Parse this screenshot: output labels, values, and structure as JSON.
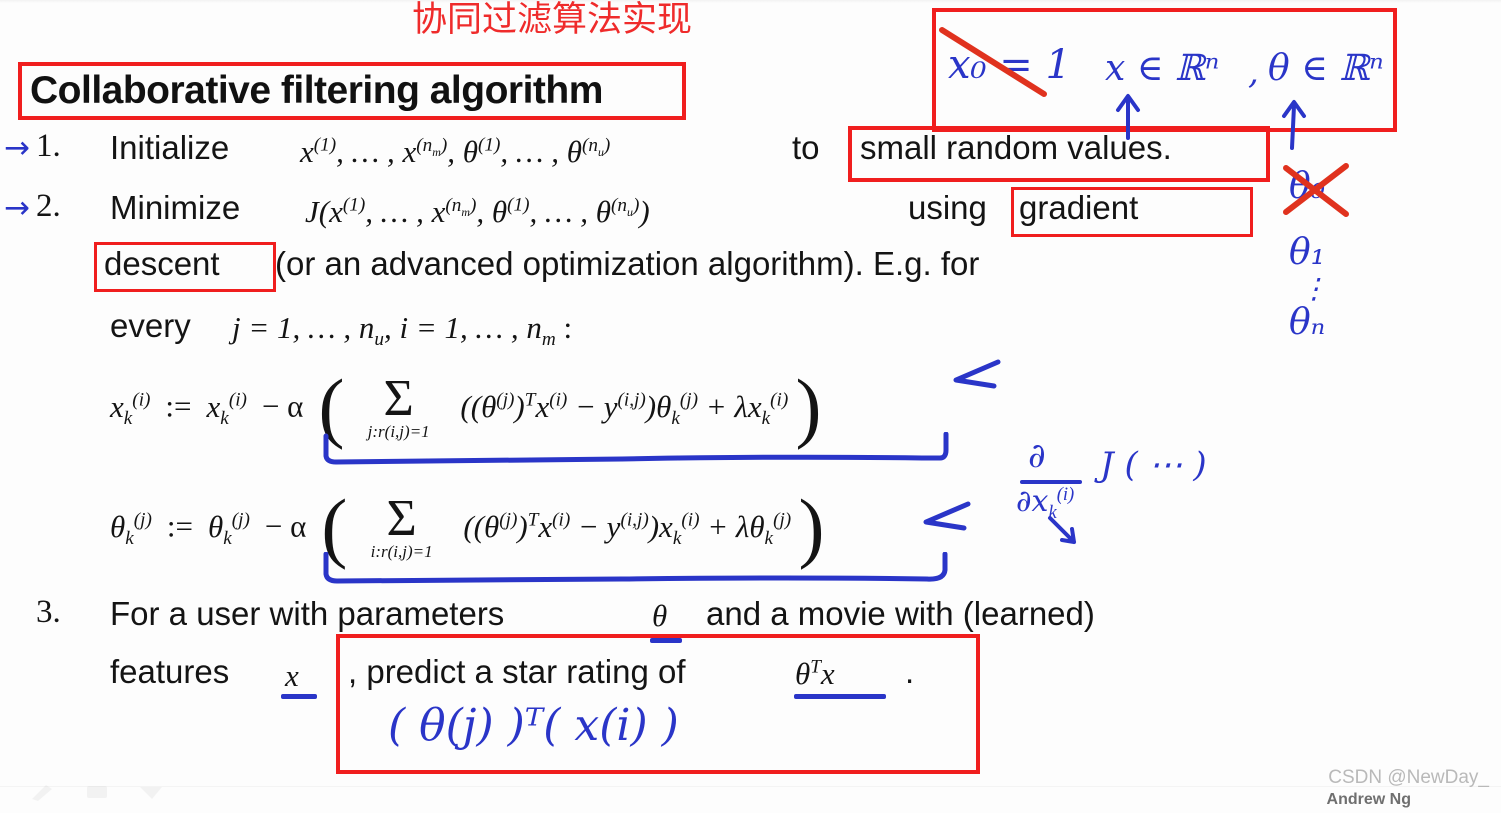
{
  "meta": {
    "cn_title": "协同过滤算法实现",
    "heading": "Collaborative filtering algorithm",
    "title_color": "#ef2b2b",
    "box_color": "#f01e1e",
    "ink_color": "#2a35c8"
  },
  "steps": {
    "one": {
      "number": "1.",
      "verb": "Initialize",
      "vars": "x(1), … , x(nm), θ(1), … , θ(nu)",
      "to": "to",
      "boxed": "small random values."
    },
    "two": {
      "number": "2.",
      "verb": "Minimize",
      "cost": "J( x(1), … , x(nm), θ(1), … , θ(nu) )",
      "using": "using",
      "boxed_gradient": "gradient",
      "boxed_descent": "descent",
      "tail": "(or an advanced optimization algorithm). E.g. for",
      "every": "every",
      "ranges": "j = 1, … , nu ,  i = 1, … , nm  :"
    },
    "three": {
      "number": "3.",
      "line1_a": "For a user with parameters",
      "line1_theta": "θ",
      "line1_b": "and a movie with (learned)",
      "line2_a": "features",
      "line2_x": "x",
      "line2_boxed": ", predict a star rating of",
      "line2_expr": "θᵀx",
      "line2_period": "."
    }
  },
  "equations": {
    "x_update": {
      "lhs": "x",
      "lhs_sub": "k",
      "lhs_sup": "(i)",
      "assign": ":=",
      "rhs_var": "x",
      "rhs_sub": "k",
      "rhs_sup": "(i)",
      "minus_alpha": "− α",
      "sum_symbol": "∑",
      "sum_limit": "j:r(i,j)=1",
      "body_1": "((θ",
      "body_sup_j": "(j)",
      "body_2": ")",
      "body_T": "T",
      "body_3": "x",
      "body_sup_i": "(i)",
      "body_4": " − y",
      "body_sup_ij": "(i,j)",
      "body_5": ")θ",
      "body_sup_j2": "(j)",
      "body_sub_k": "k",
      "body_6": " + λx",
      "body_sup_i2": "(i)",
      "body_sub_k2": "k"
    },
    "theta_update": {
      "lhs": "θ",
      "lhs_sub": "k",
      "lhs_sup": "(j)",
      "assign": ":=",
      "rhs_var": "θ",
      "rhs_sub": "k",
      "rhs_sup": "(j)",
      "minus_alpha": "− α",
      "sum_symbol": "∑",
      "sum_limit": "i:r(i,j)=1",
      "body_1": "((θ",
      "body_sup_j": "(j)",
      "body_2": ")",
      "body_T": "T",
      "body_3": "x",
      "body_sup_i": "(i)",
      "body_4": " − y",
      "body_sup_ij": "(i,j)",
      "body_5": ")x",
      "body_sup_i2": "(i)",
      "body_sub_k": "k",
      "body_6": " + λθ",
      "body_sup_j2": "(j)",
      "body_sub_k2": "k"
    }
  },
  "annotations": {
    "arrow_step1": "→",
    "arrow_step2": "→",
    "arrow_eq1": "←",
    "arrow_eq2": "←",
    "top_right": {
      "crossed_out": "x₀ = 1",
      "x_in_Rn": "x ∈ ℝⁿ",
      "comma": ",",
      "theta_in_Rn": "θ ∈ ℝⁿ",
      "arrow_up_left": "↑",
      "arrow_up_right": "↑"
    },
    "theta_list": {
      "crossed_out": "θ₀",
      "first": "θ₁",
      "dots": "⋮",
      "last": "θₙ"
    },
    "derivative": {
      "numerator": "∂",
      "denominator": "∂x",
      "denominator_sub": "k",
      "denominator_sup": "(i)",
      "function": "J ( ⋯ )"
    },
    "bottom_formula": "( θ(j) )ᵀ( x(i) )"
  },
  "footer": {
    "watermark": "CSDN @NewDay_",
    "attribution": "Andrew Ng",
    "tools": [
      "pen-tool",
      "eraser-tool",
      "highlighter-tool"
    ]
  }
}
